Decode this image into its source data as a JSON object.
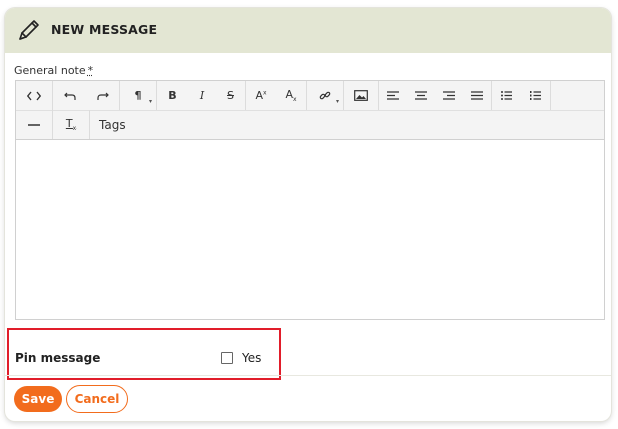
{
  "header": {
    "title": "NEW MESSAGE",
    "icon": "pencil-icon"
  },
  "form": {
    "note_label": "General note",
    "required_mark": "*",
    "toolbar": {
      "row1": [
        {
          "name": "source-code",
          "glyph": "<>"
        },
        {
          "name": "undo",
          "glyph": "↶"
        },
        {
          "name": "redo",
          "glyph": "↷"
        },
        {
          "name": "paragraph-format",
          "glyph": "¶"
        },
        {
          "name": "bold",
          "glyph": "B"
        },
        {
          "name": "italic",
          "glyph": "I"
        },
        {
          "name": "strikethrough",
          "glyph": "S"
        },
        {
          "name": "superscript",
          "glyph": "A²"
        },
        {
          "name": "subscript",
          "glyph": "A₂"
        },
        {
          "name": "link",
          "glyph": "link"
        },
        {
          "name": "image",
          "glyph": "image"
        },
        {
          "name": "align-left",
          "glyph": "left"
        },
        {
          "name": "align-center",
          "glyph": "center"
        },
        {
          "name": "align-right",
          "glyph": "right"
        },
        {
          "name": "align-justify",
          "glyph": "justify"
        },
        {
          "name": "bullet-list",
          "glyph": "ul"
        },
        {
          "name": "numbered-list",
          "glyph": "ol"
        }
      ],
      "row2": [
        {
          "name": "horizontal-rule",
          "glyph": "—"
        },
        {
          "name": "clear-format",
          "glyph": "Tx"
        }
      ],
      "tags_label": "Tags"
    },
    "content": ""
  },
  "pin": {
    "label": "Pin message",
    "option": "Yes",
    "checked": false
  },
  "actions": {
    "save": "Save",
    "cancel": "Cancel"
  },
  "colors": {
    "accent": "#f26c1d",
    "header_bg": "#e3e6d3",
    "highlight": "#e11d2a"
  }
}
